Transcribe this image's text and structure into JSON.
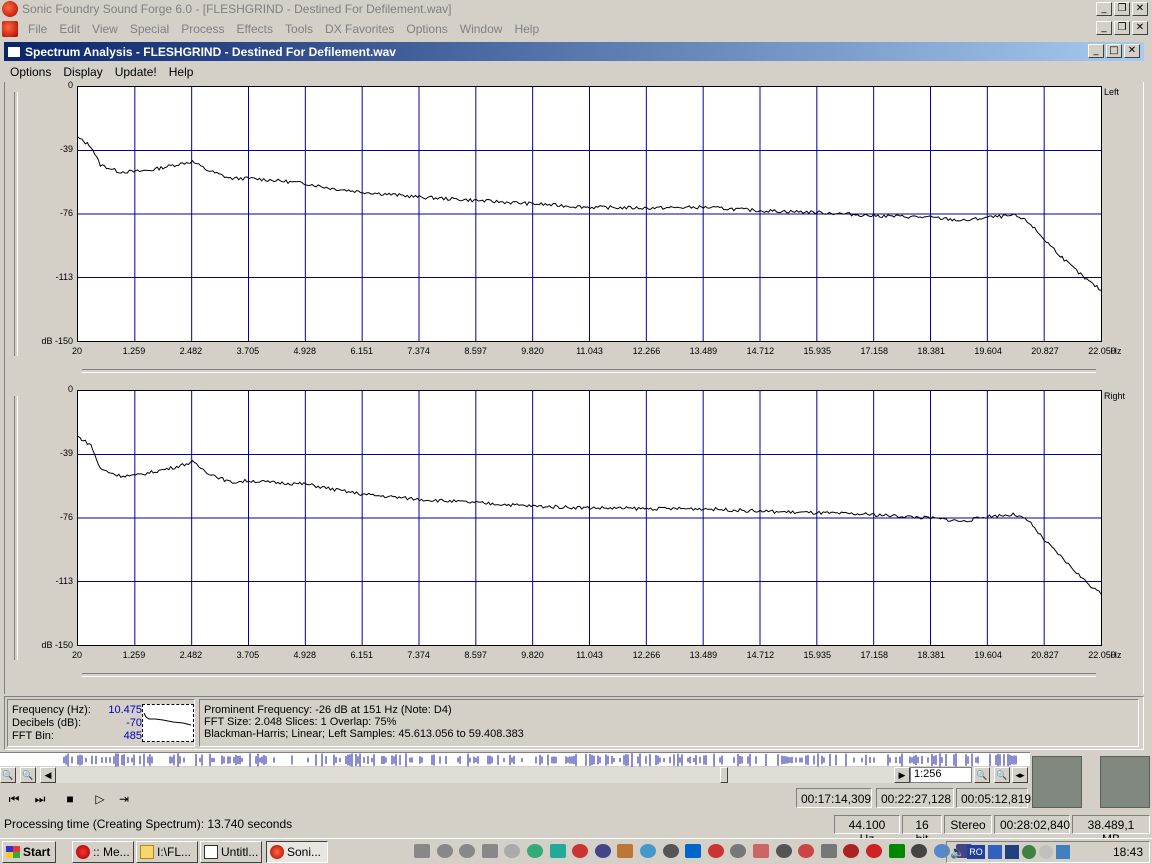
{
  "app": {
    "title": "Sonic Foundry Sound Forge 6.0 - [FLESHGRIND - Destined For Defilement.wav]",
    "menu": [
      "File",
      "Edit",
      "View",
      "Special",
      "Process",
      "Effects",
      "Tools",
      "DX Favorites",
      "Options",
      "Window",
      "Help"
    ]
  },
  "window": {
    "title": "Spectrum Analysis - FLESHGRIND - Destined For Defilement.wav",
    "menu": [
      "Options",
      "Display",
      "Update!",
      "Help"
    ],
    "min_label": "_",
    "max_label": "□",
    "close_label": "✕",
    "restore_label": "❐"
  },
  "plots": [
    {
      "channel": "Left",
      "yticks": [
        "0",
        "-39",
        "-76",
        "-113",
        "dB -150"
      ],
      "xticks": [
        "20",
        "1.259",
        "2.482",
        "3.705",
        "4.928",
        "6.151",
        "7.374",
        "8.597",
        "9.820",
        "11.043",
        "12.266",
        "13.489",
        "14.712",
        "15.935",
        "17.158",
        "18.381",
        "19.604",
        "20.827",
        "22.050"
      ],
      "unit": "Hz"
    },
    {
      "channel": "Right",
      "yticks": [
        "0",
        "-39",
        "-76",
        "-113",
        "dB -150"
      ],
      "xticks": [
        "20",
        "1.259",
        "2.482",
        "3.705",
        "4.928",
        "6.151",
        "7.374",
        "8.597",
        "9.820",
        "11.043",
        "12.266",
        "13.489",
        "14.712",
        "15.935",
        "17.158",
        "18.381",
        "19.604",
        "20.827",
        "22.050"
      ],
      "unit": "Hz"
    }
  ],
  "chart_data": [
    {
      "type": "line",
      "title": "",
      "series": [
        {
          "name": "Left"
        }
      ],
      "xlabel": "Hz",
      "ylabel": "dB",
      "xlim": [
        20,
        22050
      ],
      "ylim": [
        -150,
        0
      ],
      "points": [
        [
          20,
          -30
        ],
        [
          300,
          -35
        ],
        [
          500,
          -46
        ],
        [
          900,
          -50
        ],
        [
          1259,
          -50
        ],
        [
          1600,
          -49
        ],
        [
          2100,
          -46
        ],
        [
          2482,
          -44
        ],
        [
          2800,
          -49
        ],
        [
          3300,
          -54
        ],
        [
          3705,
          -54
        ],
        [
          4200,
          -55
        ],
        [
          4928,
          -57
        ],
        [
          5500,
          -60
        ],
        [
          6151,
          -62
        ],
        [
          7374,
          -65
        ],
        [
          8597,
          -67
        ],
        [
          9820,
          -69
        ],
        [
          11043,
          -71
        ],
        [
          12266,
          -71.5
        ],
        [
          13489,
          -71
        ],
        [
          14712,
          -73
        ],
        [
          15935,
          -74
        ],
        [
          17158,
          -76
        ],
        [
          18381,
          -77
        ],
        [
          19100,
          -79
        ],
        [
          19604,
          -77
        ],
        [
          20200,
          -76
        ],
        [
          20500,
          -80
        ],
        [
          20827,
          -90
        ],
        [
          21300,
          -103
        ],
        [
          21700,
          -113
        ],
        [
          22050,
          -120
        ]
      ]
    },
    {
      "type": "line",
      "title": "",
      "series": [
        {
          "name": "Right"
        }
      ],
      "xlabel": "Hz",
      "ylabel": "dB",
      "xlim": [
        20,
        22050
      ],
      "ylim": [
        -150,
        0
      ],
      "points": [
        [
          20,
          -27
        ],
        [
          300,
          -32
        ],
        [
          500,
          -46
        ],
        [
          900,
          -50
        ],
        [
          1259,
          -50
        ],
        [
          1600,
          -48
        ],
        [
          2100,
          -45
        ],
        [
          2482,
          -42
        ],
        [
          2800,
          -48
        ],
        [
          3300,
          -54
        ],
        [
          3705,
          -53
        ],
        [
          4200,
          -54
        ],
        [
          4928,
          -55
        ],
        [
          5500,
          -58
        ],
        [
          6151,
          -61
        ],
        [
          7374,
          -64
        ],
        [
          8597,
          -66
        ],
        [
          9820,
          -68
        ],
        [
          11043,
          -69
        ],
        [
          12266,
          -69.5
        ],
        [
          13489,
          -69.5
        ],
        [
          14712,
          -71
        ],
        [
          15935,
          -72
        ],
        [
          17158,
          -73
        ],
        [
          18381,
          -75
        ],
        [
          19100,
          -77
        ],
        [
          19604,
          -74
        ],
        [
          20200,
          -73
        ],
        [
          20500,
          -77
        ],
        [
          20827,
          -88
        ],
        [
          21300,
          -101
        ],
        [
          21700,
          -112
        ],
        [
          22050,
          -120
        ]
      ]
    }
  ],
  "info": {
    "frequency_label": "Frequency (Hz):",
    "frequency_value": "10.475",
    "decibels_label": "Decibels (dB):",
    "decibels_value": "-70",
    "fftbin_label": "FFT Bin:",
    "fftbin_value": "485",
    "line1": "Prominent Frequency: -26 dB at 151 Hz (Note: D4)",
    "line2": "FFT Size: 2.048  Slices: 1  Overlap: 75%",
    "line3": "Blackman-Harris; Linear; Left  Samples: 45.613.056 to 59.408.383"
  },
  "scroll": {
    "zoom": "1:256"
  },
  "transport": {
    "time1": "00:17:14,309",
    "time2": "00:22:27,128",
    "time3": "00:05:12,819"
  },
  "status": {
    "message": "Processing time (Creating Spectrum): 13.740 seconds",
    "rate": "44.100 Hz",
    "bits": "16 bit",
    "channels": "Stereo",
    "length": "00:28:02,840",
    "size": "38.489,1 MB"
  },
  "taskbar": {
    "start": "Start",
    "tasks": [
      ":: Me...",
      "I:\\FL...",
      "Untitl...",
      "Soni..."
    ],
    "clock": "18:43",
    "lang": "RO"
  }
}
